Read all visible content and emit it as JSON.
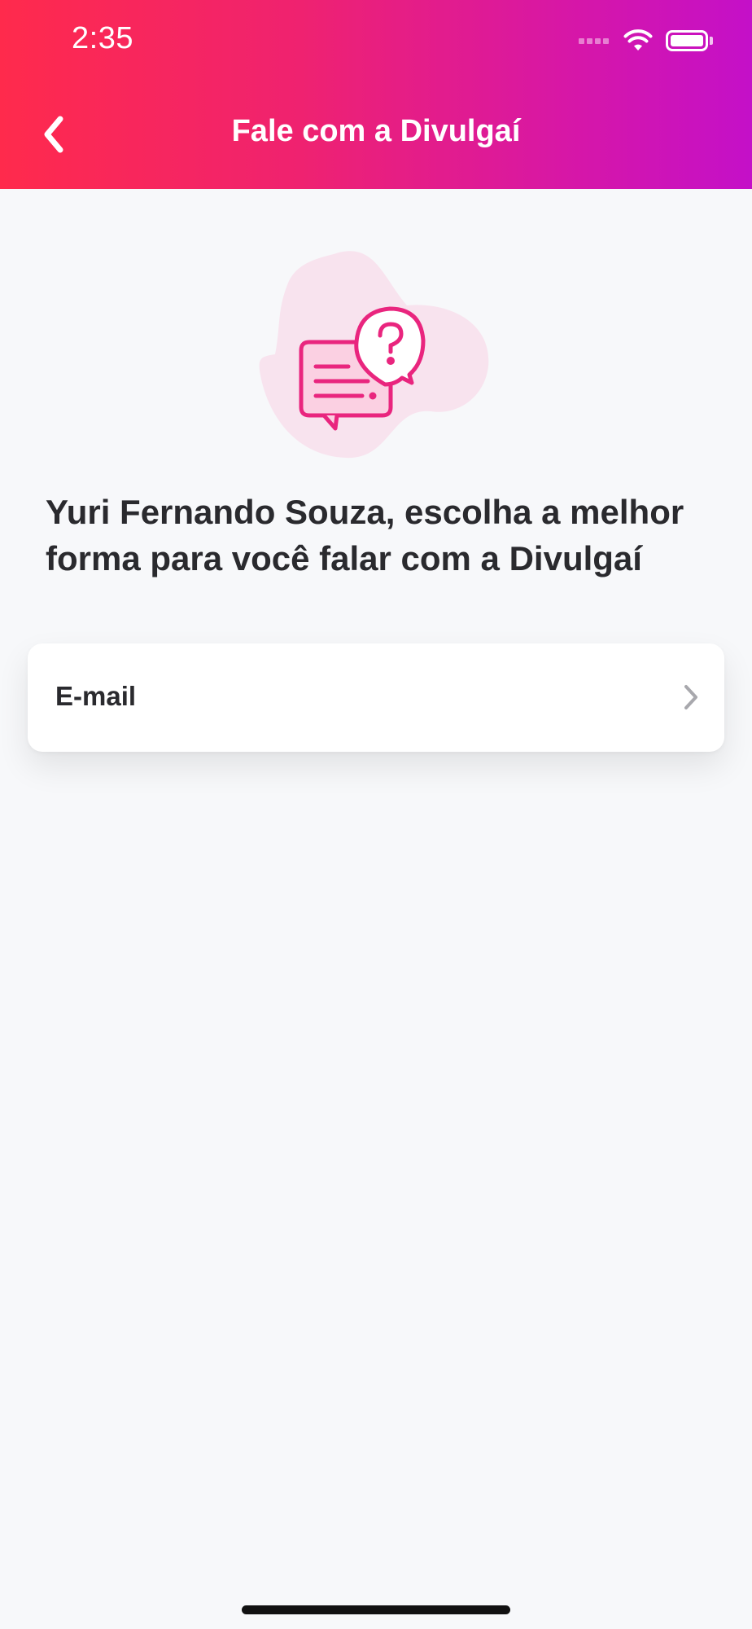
{
  "status_bar": {
    "time": "2:35"
  },
  "header": {
    "title": "Fale com a Divulgaí",
    "back_icon": "chevron-left-icon"
  },
  "illustration": {
    "icon": "chat-question-icon",
    "accent_color": "#e9257e",
    "blob_color": "#f8e3ee"
  },
  "main": {
    "headline": "Yuri Fernando Souza, escolha a melhor forma para você falar com a Divulgaí",
    "options": [
      {
        "label": "E-mail",
        "icon": "chevron-right-icon"
      }
    ]
  },
  "colors": {
    "gradient_start": "#ff2a4c",
    "gradient_end": "#c410c8",
    "background": "#f7f8fa",
    "text": "#2a2a2e"
  }
}
